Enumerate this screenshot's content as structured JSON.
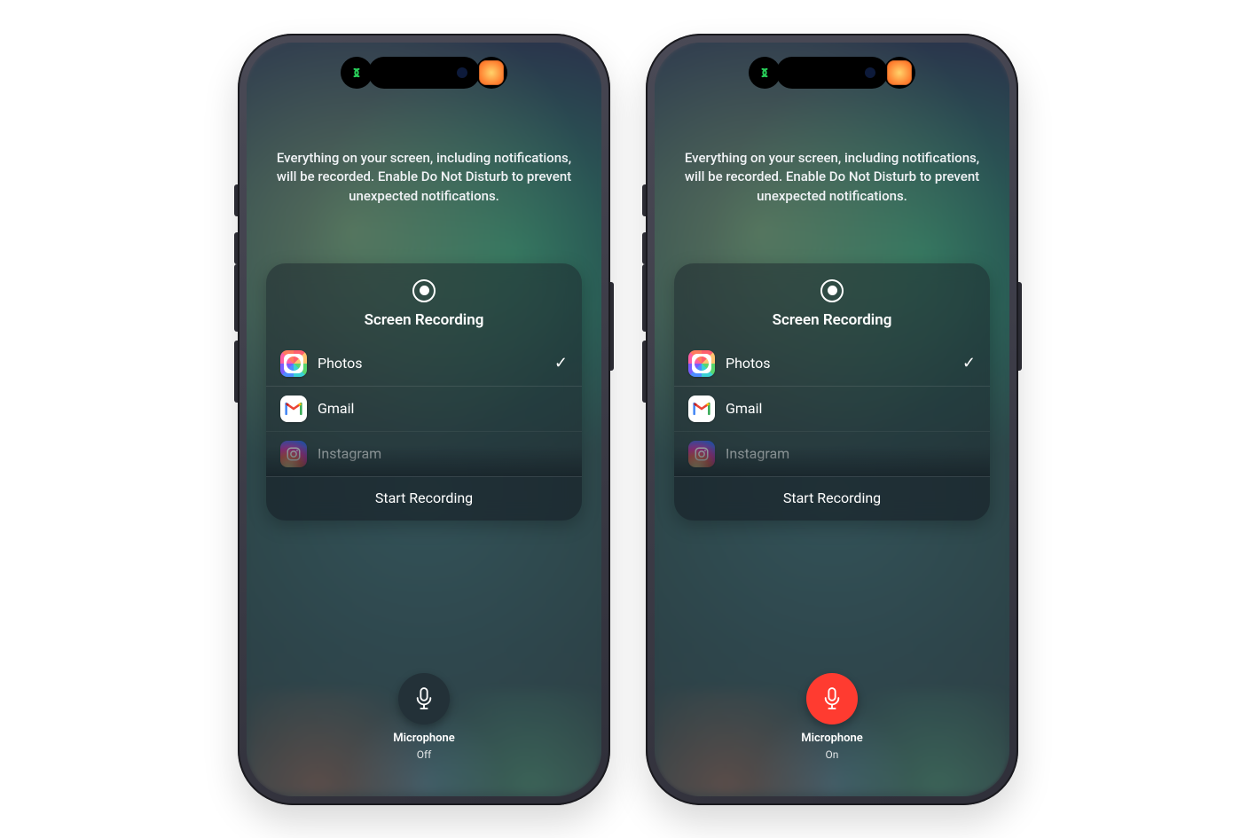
{
  "notice_text": "Everything on your screen, including notifications, will be recorded. Enable Do Not Disturb to prevent unexpected notifications.",
  "panel": {
    "title": "Screen Recording",
    "start_label": "Start Recording",
    "apps": [
      {
        "label": "Photos",
        "selected": true
      },
      {
        "label": "Gmail",
        "selected": false
      },
      {
        "label": "Instagram",
        "selected": false
      }
    ]
  },
  "microphone": {
    "label": "Microphone",
    "state_off": "Off",
    "state_on": "On"
  },
  "phones": [
    {
      "mic_on": false
    },
    {
      "mic_on": true
    }
  ],
  "colors": {
    "mic_on": "#ff3b30",
    "mic_off": "#233138"
  }
}
